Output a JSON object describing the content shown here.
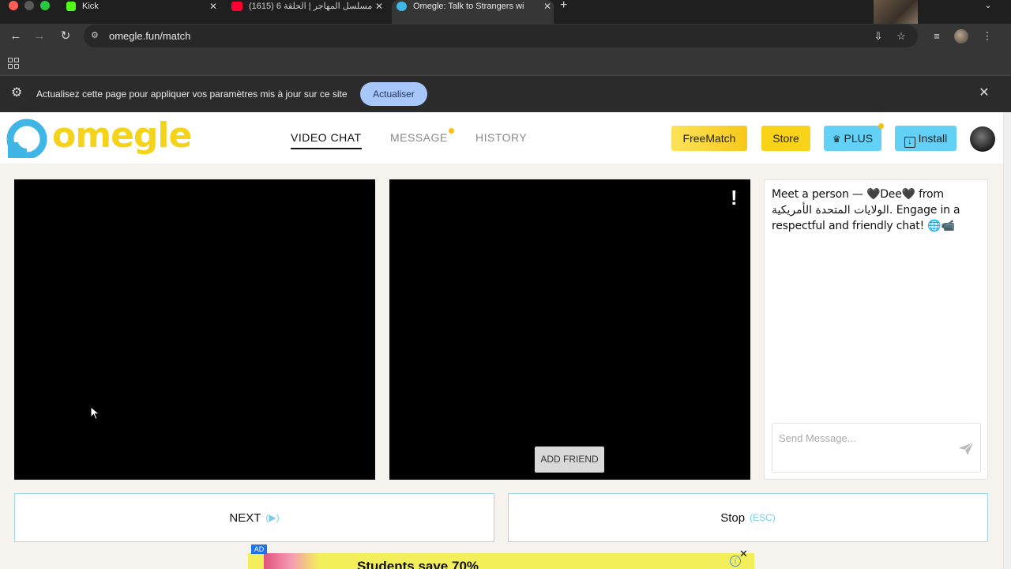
{
  "browser": {
    "tabs": [
      {
        "title": "Kick",
        "icon": "kick-favicon",
        "color": "#53fc18",
        "active": false
      },
      {
        "title": "مسلسل المهاجر | الحلقة 6 (1615)",
        "icon": "youtube-favicon",
        "color": "#ff0033",
        "active": false
      },
      {
        "title": "Omegle: Talk to Strangers wi",
        "icon": "omegle-favicon",
        "color": "#3fb6e6",
        "active": true
      }
    ],
    "new_tab": "+",
    "url": "omegle.fun/match"
  },
  "infobar": {
    "message": "Actualisez cette page pour appliquer vos paramètres mis à jour sur ce site",
    "button": "Actualiser"
  },
  "site": {
    "logo_text": "omegle",
    "nav": [
      {
        "label": "VIDEO CHAT",
        "active": true,
        "dot": false
      },
      {
        "label": "MESSAGE",
        "active": false,
        "dot": true
      },
      {
        "label": "HISTORY",
        "active": false,
        "dot": false
      }
    ],
    "buttons": {
      "freematch": "FreeMatch",
      "store": "Store",
      "plus": "PLUS",
      "install": "Install"
    },
    "colors": {
      "brand_yellow": "#f5d31a",
      "accent_blue": "#62d1f5"
    }
  },
  "video": {
    "report_label": "!",
    "add_friend": "ADD FRIEND"
  },
  "chat": {
    "message": "Meet a person — 🖤Dee🖤 from الولايات المتحدة الأمريكية. Engage in a respectful and friendly chat! 🌐📹",
    "input_placeholder": "Send Message..."
  },
  "controls": {
    "next_label": "NEXT",
    "next_hint": "(▶)",
    "stop_label": "Stop",
    "stop_hint": "(ESC)"
  },
  "ad": {
    "badge": "AD",
    "text": "Students save 70%",
    "close": "✕",
    "info": "i"
  }
}
